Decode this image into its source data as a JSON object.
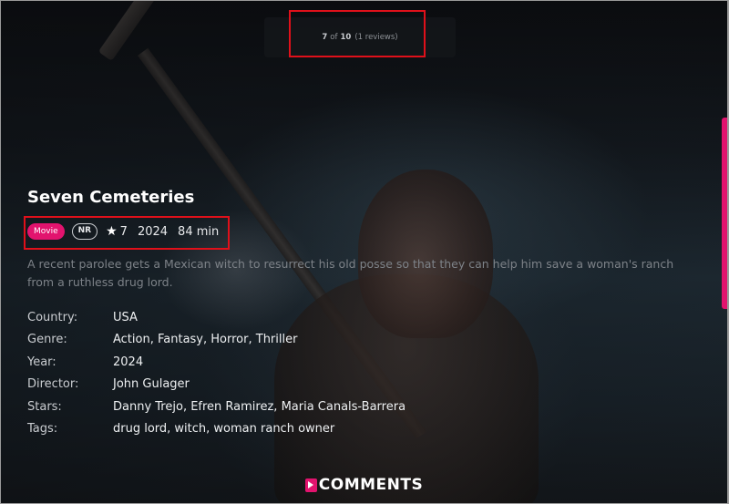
{
  "rating_box": {
    "score": "7",
    "of": "of",
    "max": "10",
    "reviews": "(1 reviews)"
  },
  "title": "Seven Cemeteries",
  "meta": {
    "type_badge": "Movie",
    "content_rating": "NR",
    "star_icon": "star-icon",
    "rating": "7",
    "year": "2024",
    "duration": "84 min"
  },
  "description": "A recent parolee gets a Mexican witch to resurrect his old posse so that they can help him save a woman's ranch from a ruthless drug lord.",
  "details": {
    "country": {
      "label": "Country:",
      "values": [
        "USA"
      ]
    },
    "genre": {
      "label": "Genre:",
      "values": [
        "Action",
        "Fantasy",
        "Horror",
        "Thriller"
      ]
    },
    "year": {
      "label": "Year:",
      "values": [
        "2024"
      ]
    },
    "director": {
      "label": "Director:",
      "values": [
        "John Gulager"
      ]
    },
    "stars": {
      "label": "Stars:",
      "values": [
        "Danny Trejo",
        "Efren Ramirez",
        "Maria Canals-Barrera"
      ]
    },
    "tags": {
      "label": "Tags:",
      "values": [
        "drug lord",
        "witch",
        "woman ranch owner"
      ]
    }
  },
  "comments": {
    "icon": "play-icon",
    "heading": "COMMENTS"
  },
  "colors": {
    "accent": "#e2136e",
    "highlight_outline": "#e0101a"
  }
}
